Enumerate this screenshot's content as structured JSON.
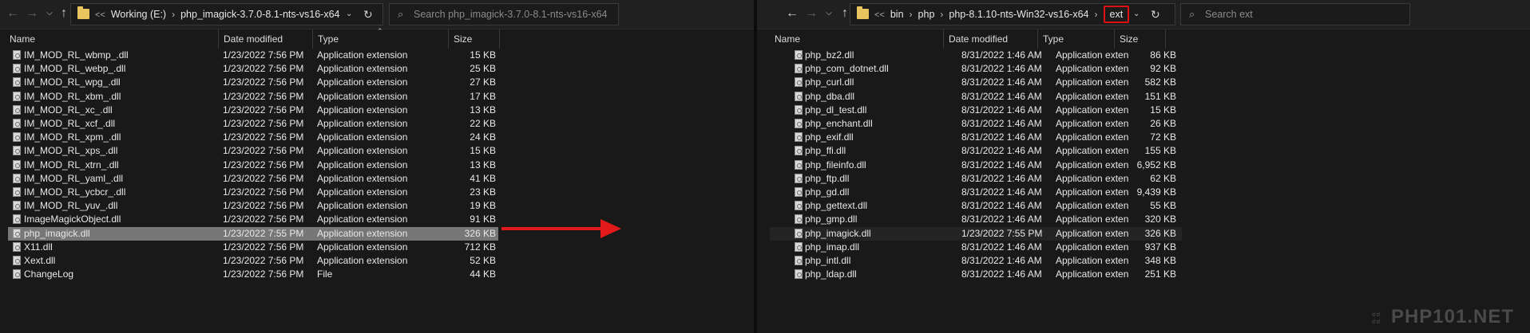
{
  "left": {
    "path": {
      "overflow": "<<",
      "crumbs": [
        "Working (E:)",
        "php_imagick-3.7.0-8.1-nts-vs16-x64"
      ]
    },
    "search_placeholder": "Search php_imagick-3.7.0-8.1-nts-vs16-x64",
    "columns": {
      "name": "Name",
      "date": "Date modified",
      "type": "Type",
      "size": "Size"
    },
    "files": [
      {
        "name": "IM_MOD_RL_wbmp_.dll",
        "date": "1/23/2022 7:56 PM",
        "type": "Application extension",
        "size": "15 KB"
      },
      {
        "name": "IM_MOD_RL_webp_.dll",
        "date": "1/23/2022 7:56 PM",
        "type": "Application extension",
        "size": "25 KB"
      },
      {
        "name": "IM_MOD_RL_wpg_.dll",
        "date": "1/23/2022 7:56 PM",
        "type": "Application extension",
        "size": "27 KB"
      },
      {
        "name": "IM_MOD_RL_xbm_.dll",
        "date": "1/23/2022 7:56 PM",
        "type": "Application extension",
        "size": "17 KB"
      },
      {
        "name": "IM_MOD_RL_xc_.dll",
        "date": "1/23/2022 7:56 PM",
        "type": "Application extension",
        "size": "13 KB"
      },
      {
        "name": "IM_MOD_RL_xcf_.dll",
        "date": "1/23/2022 7:56 PM",
        "type": "Application extension",
        "size": "22 KB"
      },
      {
        "name": "IM_MOD_RL_xpm_.dll",
        "date": "1/23/2022 7:56 PM",
        "type": "Application extension",
        "size": "24 KB"
      },
      {
        "name": "IM_MOD_RL_xps_.dll",
        "date": "1/23/2022 7:56 PM",
        "type": "Application extension",
        "size": "15 KB"
      },
      {
        "name": "IM_MOD_RL_xtrn_.dll",
        "date": "1/23/2022 7:56 PM",
        "type": "Application extension",
        "size": "13 KB"
      },
      {
        "name": "IM_MOD_RL_yaml_.dll",
        "date": "1/23/2022 7:56 PM",
        "type": "Application extension",
        "size": "41 KB"
      },
      {
        "name": "IM_MOD_RL_ycbcr_.dll",
        "date": "1/23/2022 7:56 PM",
        "type": "Application extension",
        "size": "23 KB"
      },
      {
        "name": "IM_MOD_RL_yuv_.dll",
        "date": "1/23/2022 7:56 PM",
        "type": "Application extension",
        "size": "19 KB"
      },
      {
        "name": "ImageMagickObject.dll",
        "date": "1/23/2022 7:56 PM",
        "type": "Application extension",
        "size": "91 KB"
      },
      {
        "name": "php_imagick.dll",
        "date": "1/23/2022 7:55 PM",
        "type": "Application extension",
        "size": "326 KB",
        "selected": true
      },
      {
        "name": "X11.dll",
        "date": "1/23/2022 7:56 PM",
        "type": "Application extension",
        "size": "712 KB"
      },
      {
        "name": "Xext.dll",
        "date": "1/23/2022 7:56 PM",
        "type": "Application extension",
        "size": "52 KB"
      },
      {
        "name": "ChangeLog",
        "date": "1/23/2022 7:56 PM",
        "type": "File",
        "size": "44 KB"
      }
    ]
  },
  "right": {
    "path": {
      "overflow": "<<",
      "crumbs": [
        "bin",
        "php",
        "php-8.1.10-nts-Win32-vs16-x64",
        "ext"
      ]
    },
    "search_placeholder": "Search ext",
    "columns": {
      "name": "Name",
      "date": "Date modified",
      "type": "Type",
      "size": "Size"
    },
    "files": [
      {
        "name": "php_bz2.dll",
        "date": "8/31/2022 1:46 AM",
        "type": "Application exten...",
        "size": "86 KB"
      },
      {
        "name": "php_com_dotnet.dll",
        "date": "8/31/2022 1:46 AM",
        "type": "Application exten...",
        "size": "92 KB"
      },
      {
        "name": "php_curl.dll",
        "date": "8/31/2022 1:46 AM",
        "type": "Application exten...",
        "size": "582 KB"
      },
      {
        "name": "php_dba.dll",
        "date": "8/31/2022 1:46 AM",
        "type": "Application exten...",
        "size": "151 KB"
      },
      {
        "name": "php_dl_test.dll",
        "date": "8/31/2022 1:46 AM",
        "type": "Application exten...",
        "size": "15 KB"
      },
      {
        "name": "php_enchant.dll",
        "date": "8/31/2022 1:46 AM",
        "type": "Application exten...",
        "size": "26 KB"
      },
      {
        "name": "php_exif.dll",
        "date": "8/31/2022 1:46 AM",
        "type": "Application exten...",
        "size": "72 KB"
      },
      {
        "name": "php_ffi.dll",
        "date": "8/31/2022 1:46 AM",
        "type": "Application exten...",
        "size": "155 KB"
      },
      {
        "name": "php_fileinfo.dll",
        "date": "8/31/2022 1:46 AM",
        "type": "Application exten...",
        "size": "6,952 KB"
      },
      {
        "name": "php_ftp.dll",
        "date": "8/31/2022 1:46 AM",
        "type": "Application exten...",
        "size": "62 KB"
      },
      {
        "name": "php_gd.dll",
        "date": "8/31/2022 1:46 AM",
        "type": "Application exten...",
        "size": "9,439 KB"
      },
      {
        "name": "php_gettext.dll",
        "date": "8/31/2022 1:46 AM",
        "type": "Application exten...",
        "size": "55 KB"
      },
      {
        "name": "php_gmp.dll",
        "date": "8/31/2022 1:46 AM",
        "type": "Application exten...",
        "size": "320 KB"
      },
      {
        "name": "php_imagick.dll",
        "date": "1/23/2022 7:55 PM",
        "type": "Application exten...",
        "size": "326 KB",
        "highlighted": true
      },
      {
        "name": "php_imap.dll",
        "date": "8/31/2022 1:46 AM",
        "type": "Application exten...",
        "size": "937 KB"
      },
      {
        "name": "php_intl.dll",
        "date": "8/31/2022 1:46 AM",
        "type": "Application exten...",
        "size": "348 KB"
      },
      {
        "name": "php_ldap.dll",
        "date": "8/31/2022 1:46 AM",
        "type": "Application exten...",
        "size": "251 KB"
      }
    ]
  },
  "watermark": {
    "small": "ಠಠ ಠಠ",
    "text": "PHP101.NET"
  },
  "colors": {
    "selected_row": "#777777",
    "highlighted_row": "#242424",
    "annotation_red": "#e21a1a",
    "folder": "#e8c55e"
  }
}
